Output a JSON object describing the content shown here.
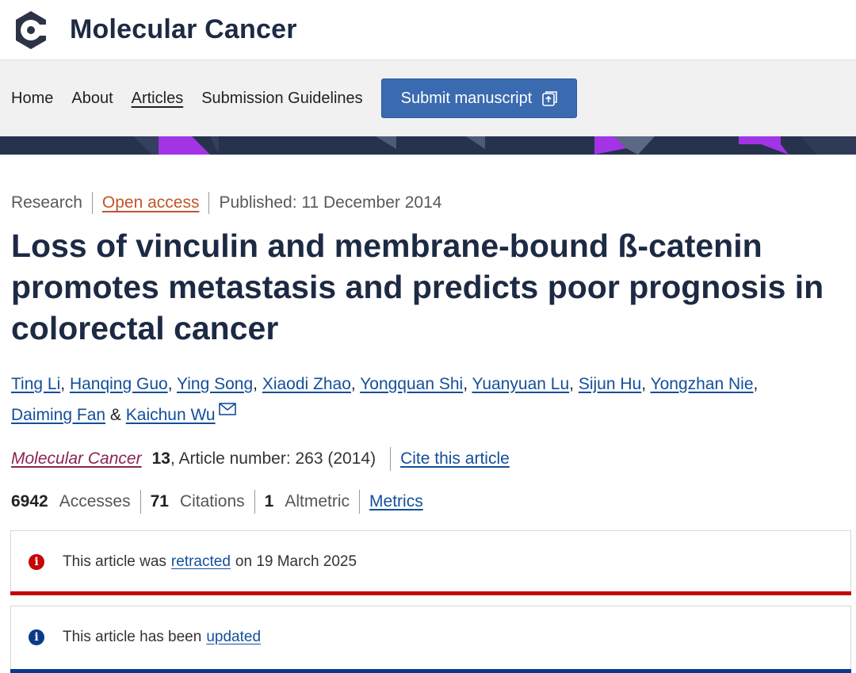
{
  "header": {
    "journal_name": "Molecular Cancer",
    "logo_icon": "molecular-cancer-logo-icon"
  },
  "nav": {
    "items": [
      {
        "label": "Home"
      },
      {
        "label": "About"
      },
      {
        "label": "Articles",
        "active": true
      },
      {
        "label": "Submission Guidelines"
      }
    ],
    "submit_label": "Submit manuscript",
    "submit_icon": "external-link-icon"
  },
  "article": {
    "type": "Research",
    "access": "Open access",
    "published": "Published: 11 December 2014",
    "title": "Loss of vinculin and membrane-bound ß-catenin promotes metastasis and predicts poor prognosis in colorectal cancer",
    "authors": [
      "Ting Li",
      "Hanqing Guo",
      "Ying Song",
      "Xiaodi Zhao",
      "Yongquan Shi",
      "Yuanyuan Lu",
      "Sijun Hu",
      "Yongzhan Nie",
      "Daiming Fan",
      "Kaichun Wu"
    ],
    "author_separator": "&",
    "citation": {
      "journal": "Molecular Cancer",
      "volume": "13",
      "article_number": ", Article number: 263 (2014)",
      "cite_label": "Cite this article"
    },
    "metrics": {
      "accesses_value": "6942",
      "accesses_label": "Accesses",
      "citations_value": "71",
      "citations_label": "Citations",
      "altmetric_value": "1",
      "altmetric_label": "Altmetric",
      "metrics_link": "Metrics"
    }
  },
  "notices": {
    "retracted": {
      "prefix": "This article was",
      "link": "retracted",
      "suffix": "on 19 March 2025",
      "color": "#c40606"
    },
    "updated": {
      "prefix": "This article has been",
      "link": "updated",
      "color": "#0b3a8a"
    }
  },
  "colors": {
    "brand_navy": "#1d2a44",
    "button_blue": "#3a6bb0",
    "link_blue": "#134f9a",
    "open_access_orange": "#c0562a",
    "journal_link": "#8b2452",
    "banner_purple": "#a234e6"
  }
}
